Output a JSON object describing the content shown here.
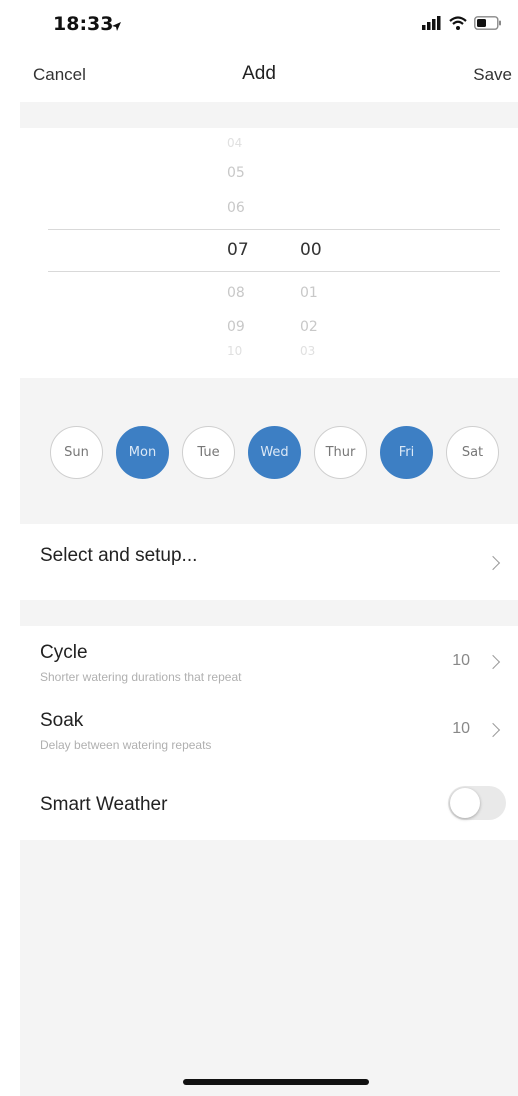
{
  "status_bar": {
    "time": "18:33",
    "icons": [
      "signal-icon",
      "wifi-icon",
      "battery-icon",
      "location-arrow-icon"
    ]
  },
  "nav": {
    "cancel": "Cancel",
    "title": "Add",
    "save": "Save"
  },
  "picker": {
    "hours": {
      "faint_top": "04",
      "dim_above": [
        "05",
        "06"
      ],
      "selected": "07",
      "dim_below": [
        "08",
        "09"
      ],
      "faint_bottom": "10"
    },
    "minutes": {
      "selected": "00",
      "dim_below": [
        "01",
        "02"
      ],
      "faint_bottom": "03"
    }
  },
  "days": [
    {
      "label": "Sun",
      "selected": false
    },
    {
      "label": "Mon",
      "selected": true
    },
    {
      "label": "Tue",
      "selected": false
    },
    {
      "label": "Wed",
      "selected": true
    },
    {
      "label": "Thur",
      "selected": false
    },
    {
      "label": "Fri",
      "selected": true
    },
    {
      "label": "Sat",
      "selected": false
    }
  ],
  "select_setup": {
    "label": "Select and setup..."
  },
  "cycle": {
    "title": "Cycle",
    "subtitle": "Shorter watering durations that repeat",
    "value": "10"
  },
  "soak": {
    "title": "Soak",
    "subtitle": "Delay between watering repeats",
    "value": "10"
  },
  "smart_weather": {
    "title": "Smart Weather",
    "enabled": false
  },
  "colors": {
    "accent": "#3d7fc4",
    "section_gray": "#f4f4f4"
  }
}
